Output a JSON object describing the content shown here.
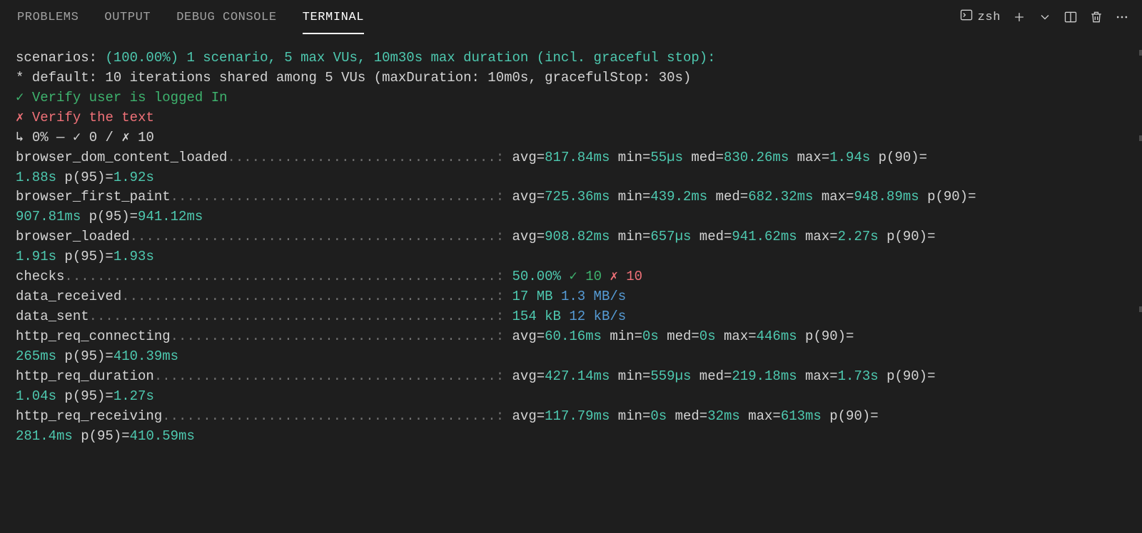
{
  "tabs": {
    "problems": "PROBLEMS",
    "output": "OUTPUT",
    "debug": "DEBUG CONSOLE",
    "terminal": "TERMINAL"
  },
  "toolbar": {
    "shell": "zsh"
  },
  "scenarios": {
    "label": "scenarios: ",
    "pct": "(100.00%)",
    "rest": " 1 scenario, 5 max VUs, 10m30s max duration (incl. graceful stop):",
    "line2_prefix": "           * default: ",
    "line2_rest": "10 iterations shared among 5 VUs (maxDuration: 10m0s, gracefulStop: 30s)"
  },
  "checks_results": {
    "pass_mark": "✓",
    "pass_text": " Verify user is logged In",
    "fail_mark": "✗",
    "fail_text": " Verify the text",
    "detail_prefix": "  ↳  ",
    "detail_pct": "0%",
    "detail_mid": " — ✓ ",
    "detail_pass": "0",
    "detail_sep": " / ✗ ",
    "detail_fail": "10"
  },
  "metric_pad": 64,
  "val_pad": 9,
  "metrics": [
    {
      "name": "browser_dom_content_loaded",
      "stats": {
        "avg": "817.84ms",
        "min": "55µs",
        "med": "830.26ms",
        "max": "1.94s",
        "p90": "1.88s",
        "p95": "1.92s"
      }
    },
    {
      "name": "browser_first_paint",
      "stats": {
        "avg": "725.36ms",
        "min": "439.2ms",
        "med": "682.32ms",
        "max": "948.89ms",
        "p90": "907.81ms",
        "p95": "941.12ms"
      }
    },
    {
      "name": "browser_loaded",
      "stats": {
        "avg": "908.82ms",
        "min": "657µs",
        "med": "941.62ms",
        "max": "2.27s",
        "p90": "1.91s",
        "p95": "1.93s"
      }
    },
    {
      "name": "checks",
      "custom": {
        "pct": "50.00%",
        "pass_mark": "✓",
        "pass": "10",
        "fail_mark": "✗",
        "fail": "10"
      }
    },
    {
      "name": "data_received",
      "custom2": {
        "size": "17 MB",
        "rate": "1.3 MB/s"
      }
    },
    {
      "name": "data_sent",
      "custom2": {
        "size": "154 kB",
        "rate": "12 kB/s"
      }
    },
    {
      "name": "http_req_connecting",
      "stats": {
        "avg": "60.16ms",
        "min": "0s",
        "med": "0s",
        "max": "446ms",
        "p90": "265ms",
        "p95": "410.39ms"
      }
    },
    {
      "name": "http_req_duration",
      "stats": {
        "avg": "427.14ms",
        "min": "559µs",
        "med": "219.18ms",
        "max": "1.73s",
        "p90": "1.04s",
        "p95": "1.27s"
      }
    },
    {
      "name": "http_req_receiving",
      "stats": {
        "avg": "117.79ms",
        "min": "0s",
        "med": "32ms",
        "max": "613ms",
        "p90": "281.4ms",
        "p95": "410.59ms"
      }
    }
  ]
}
